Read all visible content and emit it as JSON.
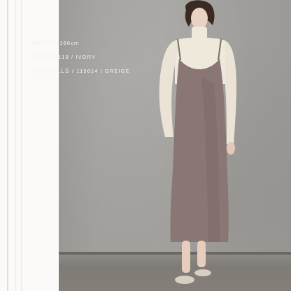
{
  "specs": [
    {
      "label": "MODEL",
      "value": "166cm"
    },
    {
      "label": "TOPS",
      "value": "/ 119 / IVORY"
    },
    {
      "label": "OVERALLS",
      "value": "/ 115614 / GREIGE"
    }
  ],
  "colors": {
    "dress": "#8a7674",
    "top": "#efe9dc",
    "wall": "#a5a39f",
    "floor": "#827d77",
    "shoes": "#d8cfc2"
  }
}
